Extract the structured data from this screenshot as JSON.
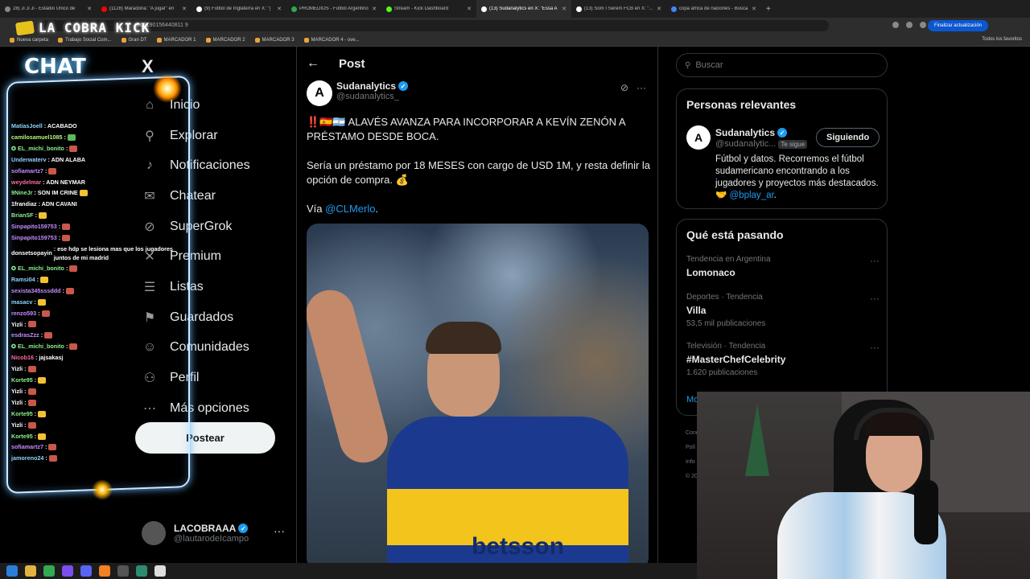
{
  "browser": {
    "tabs": [
      {
        "label": "28) Ji Ji Ji - Estadio Único de",
        "fav": "#888"
      },
      {
        "label": "(1128) Maradona: \"A jugar\" en",
        "fav": "#ff0000"
      },
      {
        "label": "(9) Fútbol de Inglaterra en X: \"|",
        "fav": "#fff"
      },
      {
        "label": "PROMEDIOS - Futbol Argentino",
        "fav": "#2fa84f"
      },
      {
        "label": "Stream - Kick Dashboard",
        "fav": "#53fc18"
      },
      {
        "label": "(13) Sudanalytics en X: \"Essa A",
        "fav": "#fff",
        "active": true
      },
      {
        "label": "(13) Som I Serem FCB en X: \"...",
        "fav": "#fff"
      },
      {
        "label": "copa africa de naciones - Busca",
        "fav": "#4285f4"
      }
    ],
    "new_tab": "+",
    "url_fragment": "866190156440811 9",
    "update_button": "Finalizar actualización",
    "bookmarks": [
      "Nueva carpeta",
      "Trabajo Social Com...",
      "Gran DT",
      "MARCADOR 1",
      "MARCADOR 2",
      "MARCADOR 3",
      "MARCADOR 4 - ove..."
    ],
    "bookmarks_right": "Todos los favoritos"
  },
  "overlay": {
    "title": "LA COBRA KICK",
    "chat_title": "CHAT",
    "messages": [
      {
        "user": "MatiasJoell",
        "color": "#8fd3ff",
        "text": ": ACABADO"
      },
      {
        "user": "camilosamuel1085",
        "color": "#b7f57a",
        "text": ": ",
        "emo": "g"
      },
      {
        "user": "✪ EL_michi_bonito",
        "color": "#8ef08e",
        "text": ": ",
        "emo": "r"
      },
      {
        "user": "Underwaterv",
        "color": "#8fd3ff",
        "text": ": ADN ALABA"
      },
      {
        "user": "sofiamartz7",
        "color": "#c58cff",
        "text": ": ",
        "emo": "r"
      },
      {
        "user": "weydelmar",
        "color": "#ff6b9a",
        "text": ": ADN NEYMAR"
      },
      {
        "user": "9NineJr",
        "color": "#8ef08e",
        "text": ": SON IM CRINE",
        "emo": "y"
      },
      {
        "user": "1frandiaz",
        "color": "#ffffff",
        "text": ": ADN CAVANI"
      },
      {
        "user": "BrianSF",
        "color": "#8ef08e",
        "text": ": ",
        "emo": "y"
      },
      {
        "user": "Sinpapito159753",
        "color": "#c58cff",
        "text": ": ",
        "emo": "r"
      },
      {
        "user": "Sinpapito159753",
        "color": "#c58cff",
        "text": ": ",
        "emo": "r"
      },
      {
        "user": "donsetsopayin",
        "color": "#ffffff",
        "text": ": ese hdp se lesiona mas que los jugadores juntos de mi madrid",
        "wrap": true
      },
      {
        "user": "✪ EL_michi_bonito",
        "color": "#8ef08e",
        "text": ": ",
        "emo": "r"
      },
      {
        "user": "Ramsi04",
        "color": "#8fd3ff",
        "text": ": ",
        "emo": "y"
      },
      {
        "user": "sexista345sssddd",
        "color": "#c58cff",
        "text": ": ",
        "emo": "r"
      },
      {
        "user": "masacv",
        "color": "#8fd3ff",
        "text": ": ",
        "emo": "y"
      },
      {
        "user": "renzo593",
        "color": "#c58cff",
        "text": ": ",
        "emo": "r"
      },
      {
        "user": "Yizli",
        "color": "#ffffff",
        "text": ": ",
        "emo": "r"
      },
      {
        "user": "esdrasZzz",
        "color": "#c58cff",
        "text": ": ",
        "emo": "r"
      },
      {
        "user": "✪ EL_michi_bonito",
        "color": "#8ef08e",
        "text": ": ",
        "emo": "r"
      },
      {
        "user": "Nicob16",
        "color": "#ff6b9a",
        "text": ": jajsakasj"
      },
      {
        "user": "Yizli",
        "color": "#ffffff",
        "text": ": ",
        "emo": "r"
      },
      {
        "user": "Korte95",
        "color": "#8ef08e",
        "text": ": ",
        "emo": "y"
      },
      {
        "user": "Yizli",
        "color": "#ffffff",
        "text": ": ",
        "emo": "r"
      },
      {
        "user": "Yizli",
        "color": "#ffffff",
        "text": ": ",
        "emo": "r"
      },
      {
        "user": "Korte95",
        "color": "#8ef08e",
        "text": ": ",
        "emo": "y"
      },
      {
        "user": "Yizli",
        "color": "#ffffff",
        "text": ": ",
        "emo": "r"
      },
      {
        "user": "Korte95",
        "color": "#8ef08e",
        "text": ": ",
        "emo": "y"
      },
      {
        "user": "sofiamartz7",
        "color": "#c58cff",
        "text": ": ",
        "emo": "r"
      },
      {
        "user": "jamoreno24",
        "color": "#8fd3ff",
        "text": ": ",
        "emo": "r"
      }
    ]
  },
  "sidebar": {
    "logo": "X",
    "items": [
      {
        "label": "Inicio",
        "icon": "home-icon",
        "glyph": "⌂"
      },
      {
        "label": "Explorar",
        "icon": "search-icon",
        "glyph": "⚲"
      },
      {
        "label": "Notificaciones",
        "icon": "bell-icon",
        "glyph": "♪"
      },
      {
        "label": "Chatear",
        "icon": "mail-icon",
        "glyph": "✉"
      },
      {
        "label": "SuperGrok",
        "icon": "grok-icon",
        "glyph": "⊘"
      },
      {
        "label": "Premium",
        "icon": "x-icon",
        "glyph": "✕"
      },
      {
        "label": "Listas",
        "icon": "list-icon",
        "glyph": "☰"
      },
      {
        "label": "Guardados",
        "icon": "bookmark-icon",
        "glyph": "⚑"
      },
      {
        "label": "Comunidades",
        "icon": "people-icon",
        "glyph": "☺"
      },
      {
        "label": "Perfil",
        "icon": "user-icon",
        "glyph": "⚇"
      },
      {
        "label": "Más opciones",
        "icon": "more-icon",
        "glyph": "⋯"
      }
    ],
    "post_button": "Postear",
    "account": {
      "name": "LACOBRAAA",
      "handle": "@lautarodeIcampo",
      "more": "···"
    }
  },
  "post": {
    "header": "Post",
    "author_name": "Sudanalytics",
    "author_handle": "@sudanalytics_",
    "avatar_letter": "A",
    "text1": "‼️🇪🇸🇦🇷 ALAVÉS AVANZA PARA INCORPORAR A KEVÍN ZENÓN A PRÉSTAMO DESDE BOCA.",
    "text2": "Sería un préstamo por 18 MESES con cargo de USD 1M, y resta definir la opción de compra. 💰",
    "via_label": "Vía ",
    "via_link": "@CLMerlo",
    "via_end": ".",
    "image_sponsor": "betsson"
  },
  "right": {
    "search_placeholder": "Buscar",
    "relevant_title": "Personas relevantes",
    "relevant": {
      "name": "Sudanalytics",
      "handle": "@sudanalytic...",
      "follows_you": "Te sigue",
      "button": "Siguiendo",
      "bio": "Fútbol y datos. Recorremos el fútbol sudamericano encontrando a los jugadores y proyectos más destacados. 🤝 ",
      "bio_link": "@bplay_ar",
      "bio_end": "."
    },
    "trends_title": "Qué está pasando",
    "trends": [
      {
        "category": "Tendencia en Argentina",
        "name": "Lomonaco",
        "count": ""
      },
      {
        "category": "Deportes · Tendencia",
        "name": "Villa",
        "count": "53,5 mil publicaciones"
      },
      {
        "category": "Televisión · Tendencia",
        "name": "#MasterChefCelebrity",
        "count": "1.620 publicaciones"
      }
    ],
    "more_link": "Mo",
    "footer": [
      "Cond",
      "Polí",
      "Info",
      "© 20"
    ]
  }
}
